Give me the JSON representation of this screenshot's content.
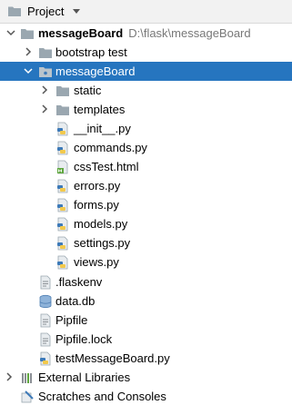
{
  "panel": {
    "title": "Project",
    "icon": "folder-icon"
  },
  "tree": {
    "root": {
      "label": "messageBoard",
      "path": "D:\\flask\\messageBoard",
      "icon": "folder-icon"
    },
    "bootstrap_test": {
      "label": "bootstrap test",
      "icon": "folder-icon"
    },
    "message_board": {
      "label": "messageBoard",
      "icon": "package-folder-icon"
    },
    "static": {
      "label": "static",
      "icon": "folder-icon"
    },
    "templates": {
      "label": "templates",
      "icon": "folder-icon"
    },
    "files_in_package": [
      {
        "label": "__init__.py",
        "icon": "python-file-icon"
      },
      {
        "label": "commands.py",
        "icon": "python-file-icon"
      },
      {
        "label": "cssTest.html",
        "icon": "html-file-icon"
      },
      {
        "label": "errors.py",
        "icon": "python-file-icon"
      },
      {
        "label": "forms.py",
        "icon": "python-file-icon"
      },
      {
        "label": "models.py",
        "icon": "python-file-icon"
      },
      {
        "label": "settings.py",
        "icon": "python-file-icon"
      },
      {
        "label": "views.py",
        "icon": "python-file-icon"
      }
    ],
    "root_files": [
      {
        "label": ".flaskenv",
        "icon": "text-file-icon"
      },
      {
        "label": "data.db",
        "icon": "database-file-icon"
      },
      {
        "label": "Pipfile",
        "icon": "text-file-icon"
      },
      {
        "label": "Pipfile.lock",
        "icon": "text-file-icon"
      },
      {
        "label": "testMessageBoard.py",
        "icon": "python-file-icon"
      }
    ],
    "external_libraries": {
      "label": "External Libraries",
      "icon": "library-icon"
    },
    "scratches": {
      "label": "Scratches and Consoles",
      "icon": "scratches-icon"
    }
  },
  "colors": {
    "selection": "#2675bf",
    "folder": "#9aa7b0",
    "python_blue": "#3d7ab8",
    "python_yellow": "#f2c94c",
    "html_green": "#5fa73f"
  }
}
